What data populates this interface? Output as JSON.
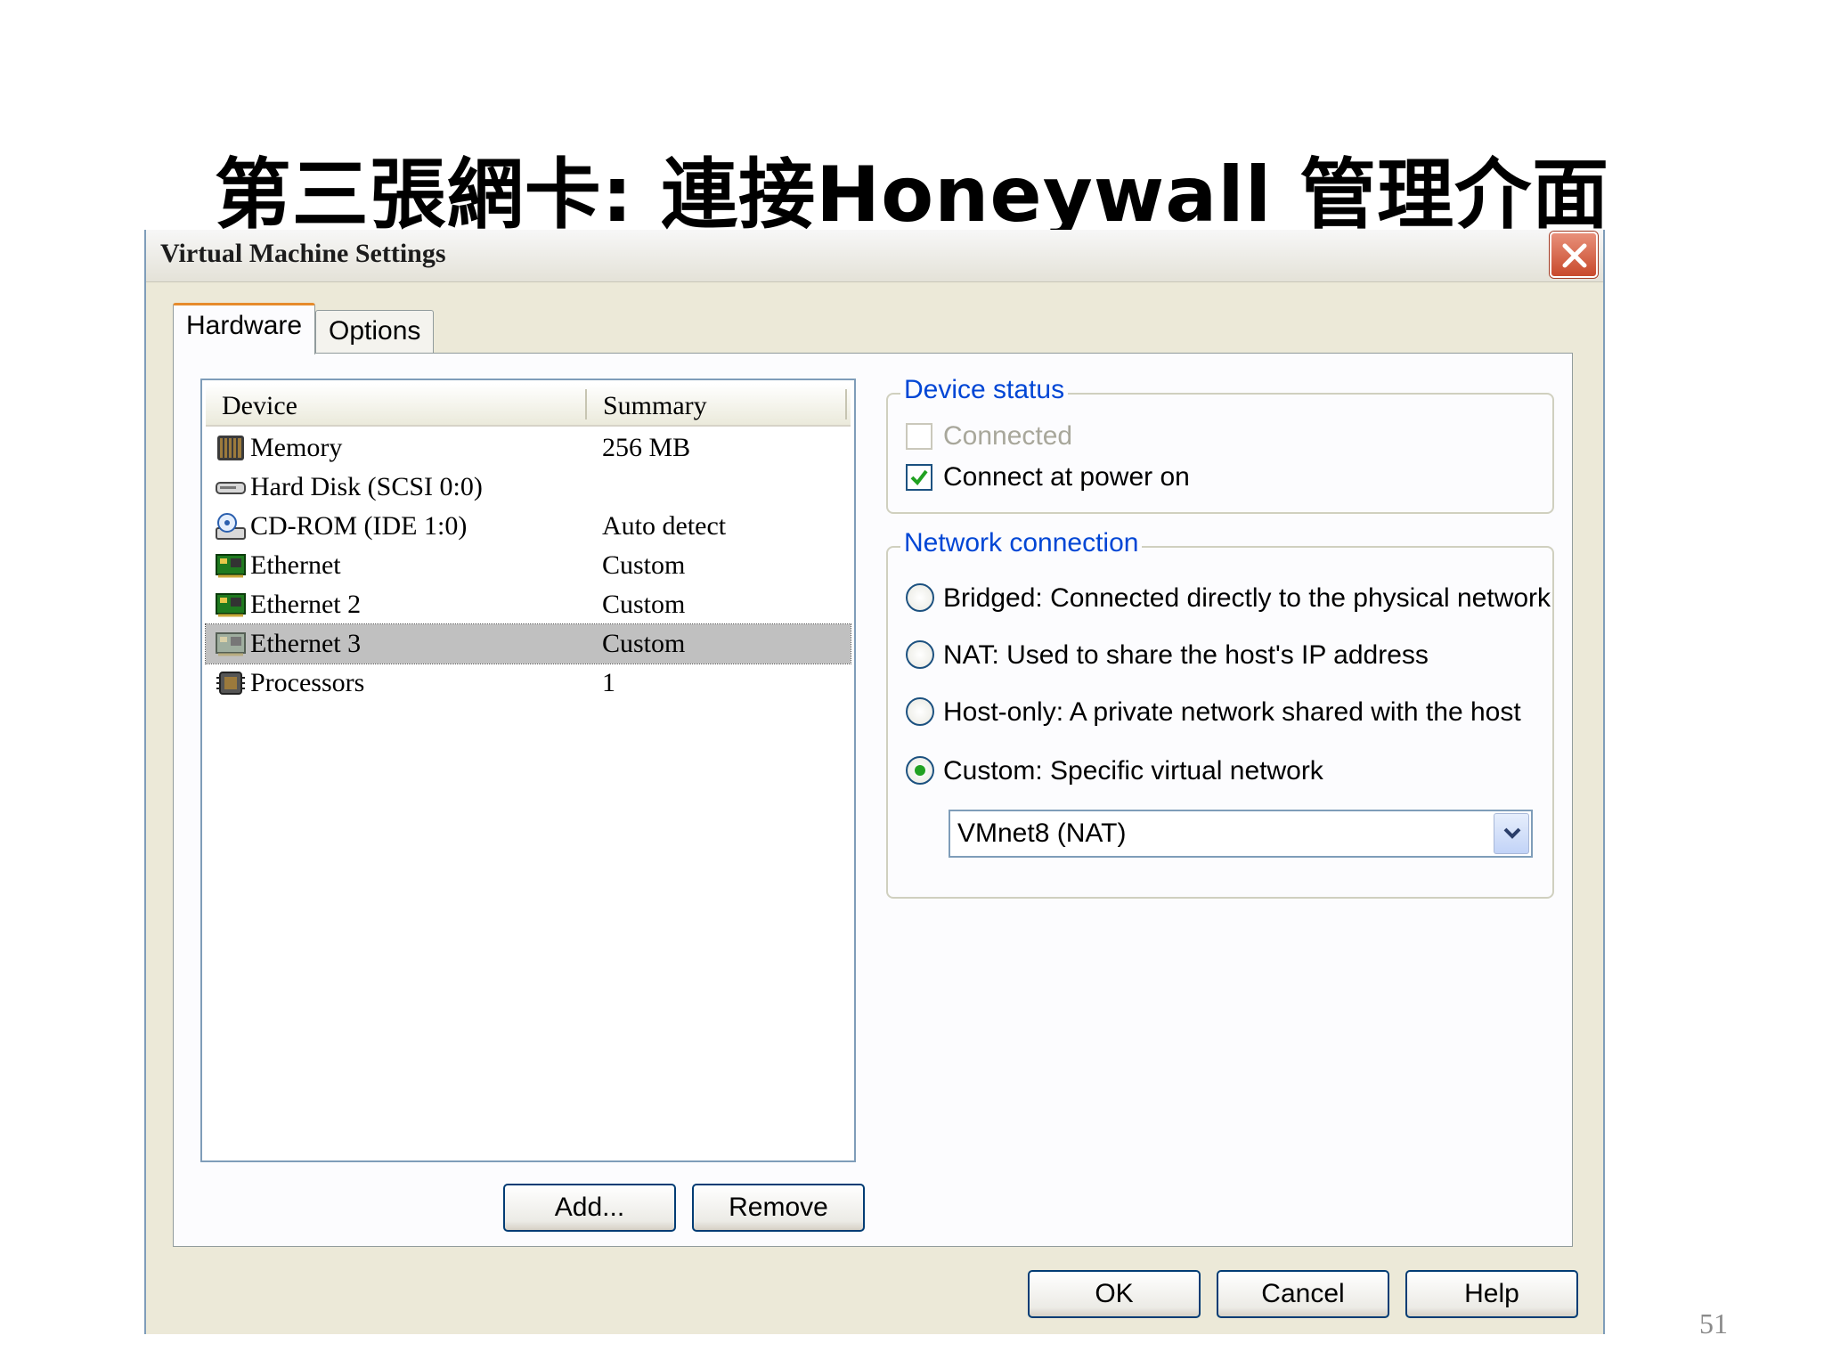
{
  "slide": {
    "title": "第三張網卡: 連接Honeywall 管理介面",
    "page_number": "51"
  },
  "window": {
    "title": "Virtual Machine Settings",
    "close_icon": "close-icon"
  },
  "tabs": [
    {
      "label": "Hardware",
      "active": true
    },
    {
      "label": "Options",
      "active": false
    }
  ],
  "device_list": {
    "columns": [
      "Device",
      "Summary"
    ],
    "rows": [
      {
        "name": "Memory",
        "summary": "256 MB",
        "icon": "memory-icon"
      },
      {
        "name": "Hard Disk (SCSI 0:0)",
        "summary": "",
        "icon": "hard-disk-icon"
      },
      {
        "name": "CD-ROM (IDE 1:0)",
        "summary": "Auto detect",
        "icon": "cdrom-icon"
      },
      {
        "name": "Ethernet",
        "summary": "Custom",
        "icon": "ethernet-icon"
      },
      {
        "name": "Ethernet 2",
        "summary": "Custom",
        "icon": "ethernet-icon"
      },
      {
        "name": "Ethernet 3",
        "summary": "Custom",
        "icon": "ethernet-icon",
        "selected": true
      },
      {
        "name": "Processors",
        "summary": "1",
        "icon": "processor-icon"
      }
    ]
  },
  "list_buttons": {
    "add_label": "Add...",
    "remove_label": "Remove"
  },
  "device_status": {
    "title": "Device status",
    "connected_label": "Connected",
    "connected_checked": false,
    "connected_disabled": true,
    "power_on_label": "Connect at power on",
    "power_on_checked": true
  },
  "network_connection": {
    "title": "Network connection",
    "options": [
      {
        "label": "Bridged: Connected directly to the physical network",
        "selected": false
      },
      {
        "label": "NAT: Used to share the host's IP address",
        "selected": false
      },
      {
        "label": "Host-only: A private network shared with the host",
        "selected": false
      },
      {
        "label": "Custom: Specific virtual network",
        "selected": true
      }
    ],
    "custom_network_value": "VMnet8 (NAT)"
  },
  "dialog_buttons": {
    "ok_label": "OK",
    "cancel_label": "Cancel",
    "help_label": "Help"
  },
  "colors": {
    "group_title": "#0046d5",
    "selection": "#c0c0c0",
    "tab_accent": "#e68b2c",
    "radio_selected": "#21a121"
  }
}
